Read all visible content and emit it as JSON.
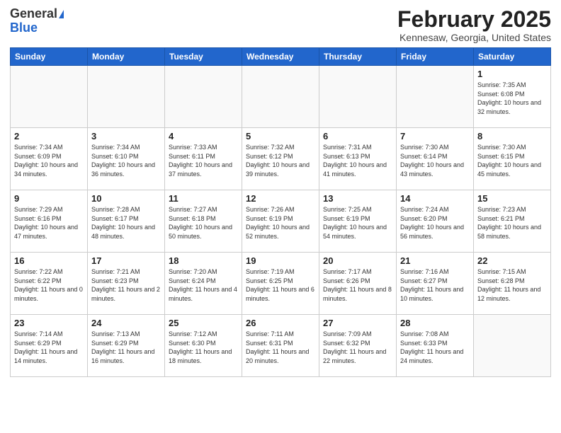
{
  "header": {
    "logo_general": "General",
    "logo_blue": "Blue",
    "month_title": "February 2025",
    "location": "Kennesaw, Georgia, United States"
  },
  "weekdays": [
    "Sunday",
    "Monday",
    "Tuesday",
    "Wednesday",
    "Thursday",
    "Friday",
    "Saturday"
  ],
  "weeks": [
    [
      {
        "day": "",
        "info": ""
      },
      {
        "day": "",
        "info": ""
      },
      {
        "day": "",
        "info": ""
      },
      {
        "day": "",
        "info": ""
      },
      {
        "day": "",
        "info": ""
      },
      {
        "day": "",
        "info": ""
      },
      {
        "day": "1",
        "info": "Sunrise: 7:35 AM\nSunset: 6:08 PM\nDaylight: 10 hours and 32 minutes."
      }
    ],
    [
      {
        "day": "2",
        "info": "Sunrise: 7:34 AM\nSunset: 6:09 PM\nDaylight: 10 hours and 34 minutes."
      },
      {
        "day": "3",
        "info": "Sunrise: 7:34 AM\nSunset: 6:10 PM\nDaylight: 10 hours and 36 minutes."
      },
      {
        "day": "4",
        "info": "Sunrise: 7:33 AM\nSunset: 6:11 PM\nDaylight: 10 hours and 37 minutes."
      },
      {
        "day": "5",
        "info": "Sunrise: 7:32 AM\nSunset: 6:12 PM\nDaylight: 10 hours and 39 minutes."
      },
      {
        "day": "6",
        "info": "Sunrise: 7:31 AM\nSunset: 6:13 PM\nDaylight: 10 hours and 41 minutes."
      },
      {
        "day": "7",
        "info": "Sunrise: 7:30 AM\nSunset: 6:14 PM\nDaylight: 10 hours and 43 minutes."
      },
      {
        "day": "8",
        "info": "Sunrise: 7:30 AM\nSunset: 6:15 PM\nDaylight: 10 hours and 45 minutes."
      }
    ],
    [
      {
        "day": "9",
        "info": "Sunrise: 7:29 AM\nSunset: 6:16 PM\nDaylight: 10 hours and 47 minutes."
      },
      {
        "day": "10",
        "info": "Sunrise: 7:28 AM\nSunset: 6:17 PM\nDaylight: 10 hours and 48 minutes."
      },
      {
        "day": "11",
        "info": "Sunrise: 7:27 AM\nSunset: 6:18 PM\nDaylight: 10 hours and 50 minutes."
      },
      {
        "day": "12",
        "info": "Sunrise: 7:26 AM\nSunset: 6:19 PM\nDaylight: 10 hours and 52 minutes."
      },
      {
        "day": "13",
        "info": "Sunrise: 7:25 AM\nSunset: 6:19 PM\nDaylight: 10 hours and 54 minutes."
      },
      {
        "day": "14",
        "info": "Sunrise: 7:24 AM\nSunset: 6:20 PM\nDaylight: 10 hours and 56 minutes."
      },
      {
        "day": "15",
        "info": "Sunrise: 7:23 AM\nSunset: 6:21 PM\nDaylight: 10 hours and 58 minutes."
      }
    ],
    [
      {
        "day": "16",
        "info": "Sunrise: 7:22 AM\nSunset: 6:22 PM\nDaylight: 11 hours and 0 minutes."
      },
      {
        "day": "17",
        "info": "Sunrise: 7:21 AM\nSunset: 6:23 PM\nDaylight: 11 hours and 2 minutes."
      },
      {
        "day": "18",
        "info": "Sunrise: 7:20 AM\nSunset: 6:24 PM\nDaylight: 11 hours and 4 minutes."
      },
      {
        "day": "19",
        "info": "Sunrise: 7:19 AM\nSunset: 6:25 PM\nDaylight: 11 hours and 6 minutes."
      },
      {
        "day": "20",
        "info": "Sunrise: 7:17 AM\nSunset: 6:26 PM\nDaylight: 11 hours and 8 minutes."
      },
      {
        "day": "21",
        "info": "Sunrise: 7:16 AM\nSunset: 6:27 PM\nDaylight: 11 hours and 10 minutes."
      },
      {
        "day": "22",
        "info": "Sunrise: 7:15 AM\nSunset: 6:28 PM\nDaylight: 11 hours and 12 minutes."
      }
    ],
    [
      {
        "day": "23",
        "info": "Sunrise: 7:14 AM\nSunset: 6:29 PM\nDaylight: 11 hours and 14 minutes."
      },
      {
        "day": "24",
        "info": "Sunrise: 7:13 AM\nSunset: 6:29 PM\nDaylight: 11 hours and 16 minutes."
      },
      {
        "day": "25",
        "info": "Sunrise: 7:12 AM\nSunset: 6:30 PM\nDaylight: 11 hours and 18 minutes."
      },
      {
        "day": "26",
        "info": "Sunrise: 7:11 AM\nSunset: 6:31 PM\nDaylight: 11 hours and 20 minutes."
      },
      {
        "day": "27",
        "info": "Sunrise: 7:09 AM\nSunset: 6:32 PM\nDaylight: 11 hours and 22 minutes."
      },
      {
        "day": "28",
        "info": "Sunrise: 7:08 AM\nSunset: 6:33 PM\nDaylight: 11 hours and 24 minutes."
      },
      {
        "day": "",
        "info": ""
      }
    ]
  ]
}
